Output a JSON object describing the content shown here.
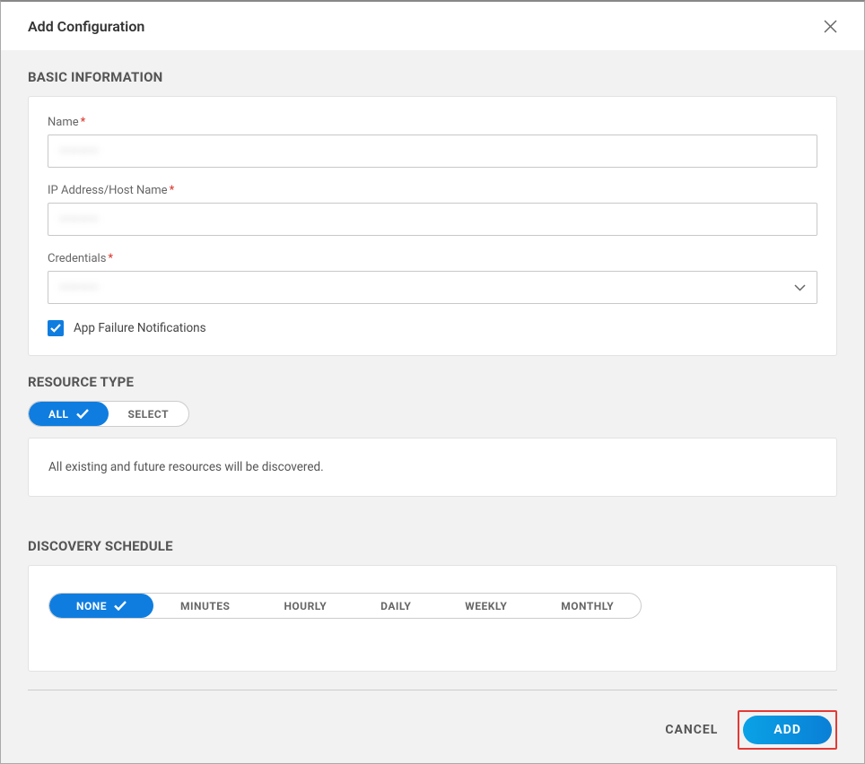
{
  "dialog": {
    "title": "Add Configuration"
  },
  "sections": {
    "basic": {
      "title": "BASIC INFORMATION",
      "fields": {
        "name": {
          "label": "Name",
          "required": "*",
          "value": "————"
        },
        "ip": {
          "label": "IP Address/Host Name",
          "required": "*",
          "value": "————"
        },
        "credentials": {
          "label": "Credentials",
          "required": "*",
          "value": "————"
        }
      },
      "checkbox": {
        "label": "App Failure Notifications",
        "checked": true
      }
    },
    "resourceType": {
      "title": "RESOURCE TYPE",
      "options": {
        "all": "ALL",
        "select": "SELECT"
      },
      "message": "All existing and future resources will be discovered."
    },
    "discovery": {
      "title": "DISCOVERY SCHEDULE",
      "options": [
        "NONE",
        "MINUTES",
        "HOURLY",
        "DAILY",
        "WEEKLY",
        "MONTHLY"
      ]
    }
  },
  "footer": {
    "cancel": "CANCEL",
    "add": "ADD"
  }
}
